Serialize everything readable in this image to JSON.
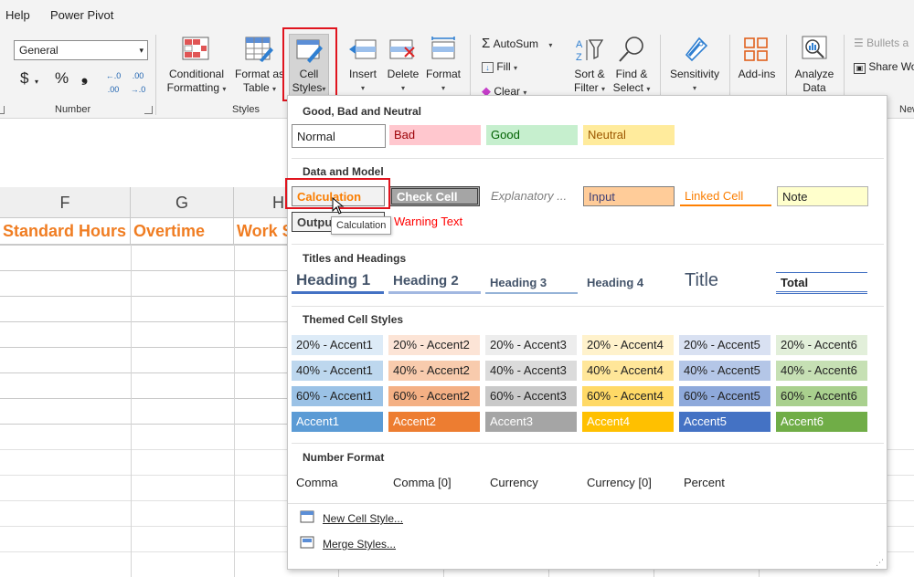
{
  "menubar": {
    "items": [
      "Help",
      "Power Pivot"
    ]
  },
  "ribbon": {
    "number_format_value": "General",
    "number_group_label": "Number",
    "styles_group_label": "Styles",
    "currency_symbol": "$",
    "percent_symbol": "%",
    "comma_symbol": "❟",
    "inc_decimal": "←.0 .00",
    "dec_decimal": ".00 →.0",
    "conditional_formatting": [
      "Conditional",
      "Formatting"
    ],
    "format_as_table": [
      "Format as",
      "Table"
    ],
    "cell_styles": [
      "Cell",
      "Styles"
    ],
    "insert": "Insert",
    "delete": "Delete",
    "format": "Format",
    "autosum": "AutoSum",
    "fill": "Fill",
    "clear": "Clear",
    "sort_filter": [
      "Sort &",
      "Filter"
    ],
    "find_select": [
      "Find &",
      "Select"
    ],
    "sensitivity": "Sensitivity",
    "addins": "Add-ins",
    "analyze_data": [
      "Analyze",
      "Data"
    ],
    "bullets": "Bullets a",
    "share": "Share Wo",
    "cut_group_label": "New"
  },
  "sheet": {
    "columns": [
      "F",
      "G",
      "H"
    ],
    "header_cells": [
      "Standard Hours",
      "Overtime",
      "Work S"
    ],
    "colors": {
      "header_text": "#f07d22"
    }
  },
  "panel": {
    "sections": {
      "good_bad": "Good, Bad and Neutral",
      "data_model": "Data and Model",
      "titles": "Titles and Headings",
      "themed": "Themed Cell Styles",
      "number_format": "Number Format"
    },
    "good_bad_styles": [
      "Normal",
      "Bad",
      "Good",
      "Neutral"
    ],
    "data_model_row1": [
      "Calculation",
      "Check Cell",
      "Explanatory ...",
      "Input",
      "Linked Cell",
      "Note"
    ],
    "data_model_row2": [
      "Output",
      "Warning Text"
    ],
    "tooltip": "Calculation",
    "titles_styles": [
      "Heading 1",
      "Heading 2",
      "Heading 3",
      "Heading 4",
      "Title",
      "Total"
    ],
    "themed_rows": [
      [
        "20% - Accent1",
        "20% - Accent2",
        "20% - Accent3",
        "20% - Accent4",
        "20% - Accent5",
        "20% - Accent6"
      ],
      [
        "40% - Accent1",
        "40% - Accent2",
        "40% - Accent3",
        "40% - Accent4",
        "40% - Accent5",
        "40% - Accent6"
      ],
      [
        "60% - Accent1",
        "60% - Accent2",
        "60% - Accent3",
        "60% - Accent4",
        "60% - Accent5",
        "60% - Accent6"
      ],
      [
        "Accent1",
        "Accent2",
        "Accent3",
        "Accent4",
        "Accent5",
        "Accent6"
      ]
    ],
    "number_styles": [
      "Comma",
      "Comma [0]",
      "Currency",
      "Currency [0]",
      "Percent"
    ],
    "footer": {
      "new_cell_style": "New Cell Style...",
      "merge_styles": "Merge Styles..."
    }
  }
}
